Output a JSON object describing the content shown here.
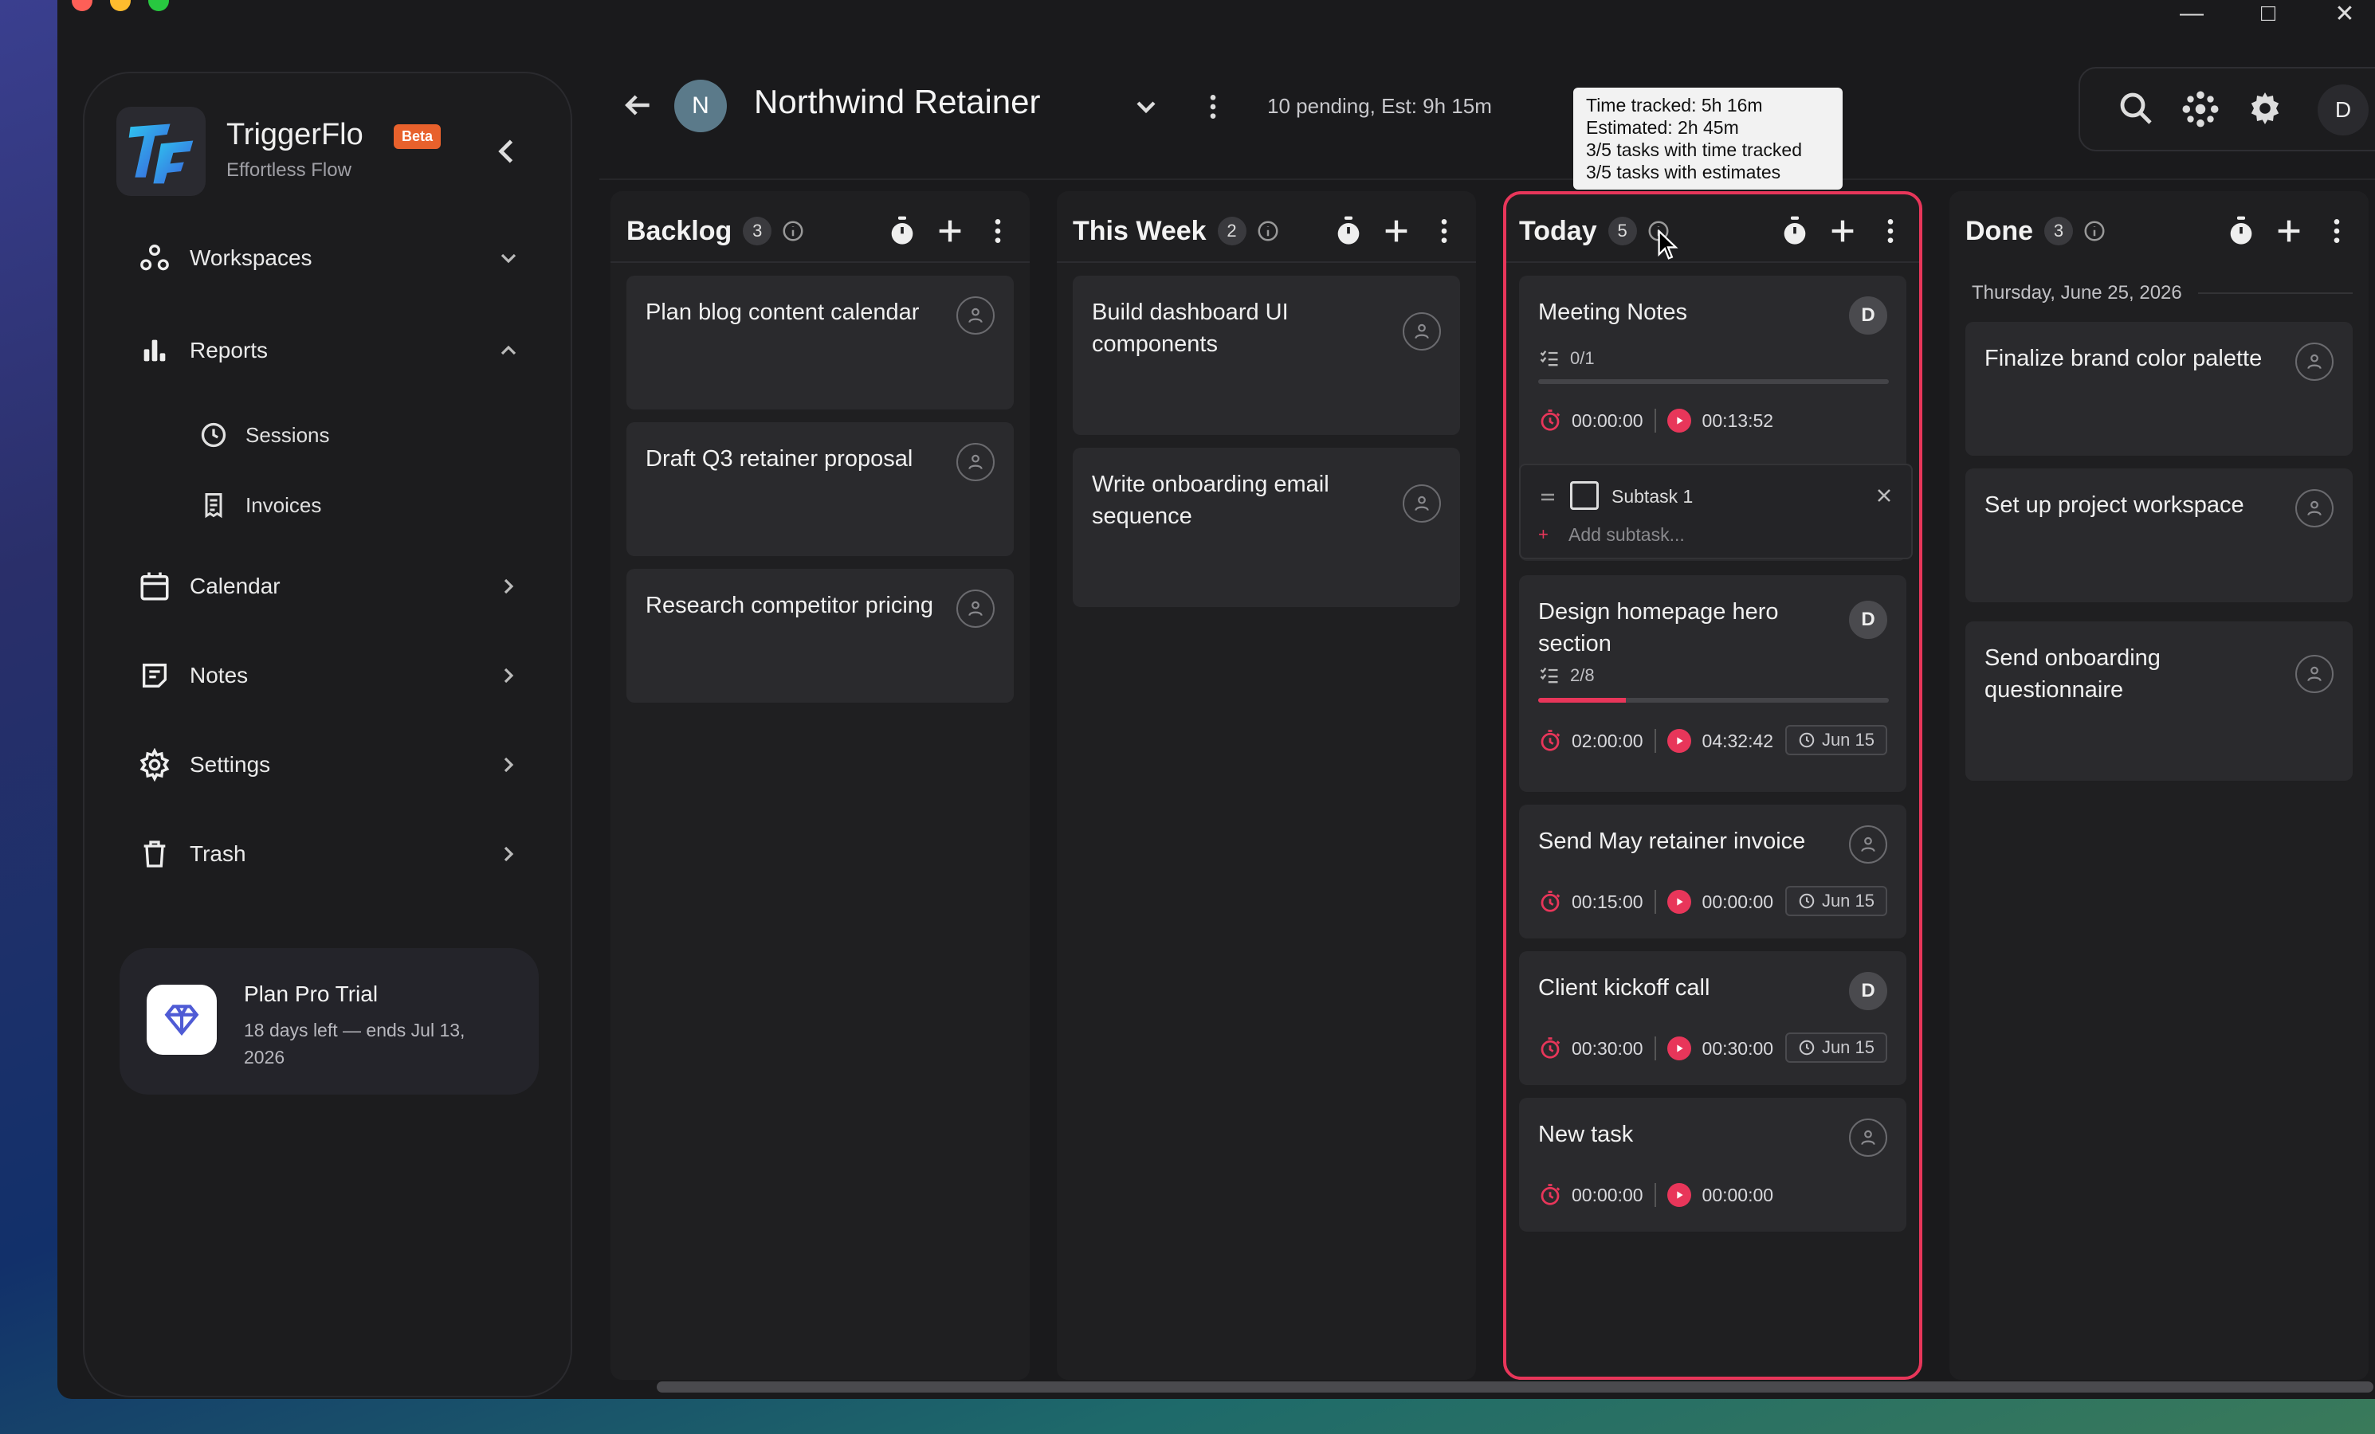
{
  "app": {
    "name": "TriggerFlo",
    "badge": "Beta",
    "tagline": "Effortless Flow"
  },
  "sidebar": {
    "items": [
      {
        "label": "Workspaces",
        "icon": "workspaces-icon"
      },
      {
        "label": "Reports",
        "icon": "bar-chart-icon"
      },
      {
        "label": "Calendar",
        "icon": "calendar-icon"
      },
      {
        "label": "Notes",
        "icon": "notes-icon"
      },
      {
        "label": "Settings",
        "icon": "gear-icon"
      },
      {
        "label": "Trash",
        "icon": "trash-icon"
      }
    ],
    "reports_children": [
      {
        "label": "Sessions",
        "icon": "clock-icon"
      },
      {
        "label": "Invoices",
        "icon": "receipt-icon"
      }
    ],
    "plan": {
      "title": "Plan Pro Trial",
      "subtitle": "18 days left — ends Jul 13, 2026"
    }
  },
  "header": {
    "project_initial": "N",
    "project_name": "Northwind Retainer",
    "pending_summary": "10 pending, Est: 9h 15m",
    "user_initial": "D"
  },
  "tooltip": {
    "lines": [
      "Time tracked: 5h 16m",
      "Estimated: 2h 45m",
      "3/5 tasks with time tracked",
      "3/5 tasks with estimates"
    ]
  },
  "columns": [
    {
      "title": "Backlog",
      "count": "3",
      "cards": [
        {
          "title": "Plan blog content calendar"
        },
        {
          "title": "Draft Q3 retainer proposal"
        },
        {
          "title": "Research competitor pricing"
        }
      ]
    },
    {
      "title": "This Week",
      "count": "2",
      "cards": [
        {
          "title": "Build dashboard UI components"
        },
        {
          "title": "Write onboarding email sequence"
        }
      ]
    },
    {
      "title": "Today",
      "count": "5",
      "cards": [
        {
          "title": "Meeting Notes",
          "assignee": "D",
          "subtasks": "0/1",
          "progress": 0,
          "estimate": "00:00:00",
          "tracked": "00:13:52"
        },
        {
          "title": "Design homepage hero section",
          "assignee": "D",
          "subtasks": "2/8",
          "progress": 0.25,
          "estimate": "02:00:00",
          "tracked": "04:32:42",
          "due": "Jun 15"
        },
        {
          "title": "Send May retainer invoice",
          "estimate": "00:15:00",
          "tracked": "00:00:00",
          "due": "Jun 15"
        },
        {
          "title": "Client kickoff call",
          "assignee": "D",
          "estimate": "00:30:00",
          "tracked": "00:30:00",
          "due": "Jun 15"
        },
        {
          "title": "New task",
          "estimate": "00:00:00",
          "tracked": "00:00:00"
        }
      ],
      "subtask_panel": {
        "subtask_label": "Subtask 1",
        "add_placeholder": "Add subtask..."
      }
    },
    {
      "title": "Done",
      "count": "3",
      "date_group": "Thursday, June 25, 2026",
      "cards": [
        {
          "title": "Finalize brand color palette"
        },
        {
          "title": "Set up project workspace"
        },
        {
          "title": "Send onboarding questionnaire"
        }
      ]
    }
  ],
  "colors": {
    "accent": "#e8365a",
    "beta_badge": "#e8612c",
    "background": "#1a1a1c"
  }
}
